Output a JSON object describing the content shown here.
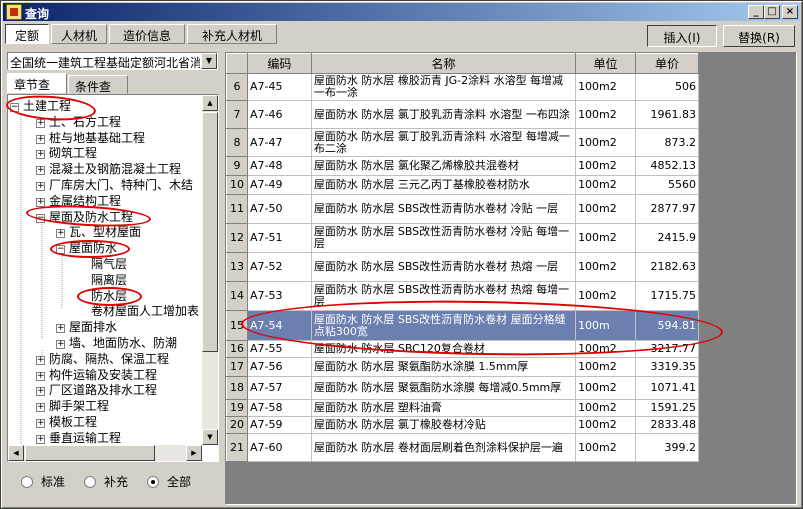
{
  "window": {
    "title": "查询",
    "controls": [
      "_",
      "□",
      "×"
    ]
  },
  "main_tabs": [
    {
      "label": "定额",
      "active": true
    },
    {
      "label": "人材机",
      "active": false
    },
    {
      "label": "造价信息",
      "active": false
    },
    {
      "label": "补充人材机",
      "active": false
    }
  ],
  "toolbar": {
    "insert_label": "插入(I)",
    "replace_label": "替换(R)"
  },
  "left": {
    "quota_select": "全国统一建筑工程基础定额河北省消",
    "sub_tabs": [
      {
        "label": "章节查询",
        "active": true
      },
      {
        "label": "条件查询",
        "active": false
      }
    ],
    "tree": [
      {
        "label": "土建工程",
        "level": 0,
        "exp": "−"
      },
      {
        "label": "土、石方工程",
        "level": 1,
        "exp": "+"
      },
      {
        "label": "桩与地基基础工程",
        "level": 1,
        "exp": "+"
      },
      {
        "label": "砌筑工程",
        "level": 1,
        "exp": "+"
      },
      {
        "label": "混凝土及钢筋混凝土工程",
        "level": 1,
        "exp": "+"
      },
      {
        "label": "厂库房大门、特种门、木结",
        "level": 1,
        "exp": "+"
      },
      {
        "label": "金属结构工程",
        "level": 1,
        "exp": "+"
      },
      {
        "label": "屋面及防水工程",
        "level": 1,
        "exp": "−"
      },
      {
        "label": "瓦、型材屋面",
        "level": 2,
        "exp": "+"
      },
      {
        "label": "屋面防水",
        "level": 2,
        "exp": "−"
      },
      {
        "label": "隔气层",
        "level": 3,
        "exp": ""
      },
      {
        "label": "隔离层",
        "level": 3,
        "exp": ""
      },
      {
        "label": "防水层",
        "level": 3,
        "exp": ""
      },
      {
        "label": "卷材屋面人工增加表",
        "level": 3,
        "exp": ""
      },
      {
        "label": "屋面排水",
        "level": 2,
        "exp": "+"
      },
      {
        "label": "墙、地面防水、防潮",
        "level": 2,
        "exp": "+"
      },
      {
        "label": "防腐、隔热、保温工程",
        "level": 1,
        "exp": "+"
      },
      {
        "label": "构件运输及安装工程",
        "level": 1,
        "exp": "+"
      },
      {
        "label": "厂区道路及排水工程",
        "level": 1,
        "exp": "+"
      },
      {
        "label": "脚手架工程",
        "level": 1,
        "exp": "+"
      },
      {
        "label": "模板工程",
        "level": 1,
        "exp": "+"
      },
      {
        "label": "垂直运输工程",
        "level": 1,
        "exp": "+"
      }
    ],
    "radios": [
      {
        "label": "标准",
        "checked": false
      },
      {
        "label": "补充",
        "checked": false
      },
      {
        "label": "全部",
        "checked": true
      }
    ]
  },
  "grid": {
    "columns": [
      "编码",
      "名称",
      "单位",
      "单价"
    ],
    "rows": [
      {
        "n": "6",
        "code": "A7-45",
        "name": "屋面防水 防水层 橡胶沥青 JG-2涂料 水溶型 每增减一布一涂",
        "unit": "100m2",
        "price": "506"
      },
      {
        "n": "7",
        "code": "A7-46",
        "name": "屋面防水 防水层 氯丁胶乳沥青涂料 水溶型 一布四涂",
        "unit": "100m2",
        "price": "1961.83"
      },
      {
        "n": "8",
        "code": "A7-47",
        "name": "屋面防水 防水层 氯丁胶乳沥青涂料 水溶型 每增减一布二涂",
        "unit": "100m2",
        "price": "873.2"
      },
      {
        "n": "9",
        "code": "A7-48",
        "name": "屋面防水 防水层 氯化聚乙烯橡胶共混卷材",
        "unit": "100m2",
        "price": "4852.13"
      },
      {
        "n": "10",
        "code": "A7-49",
        "name": "屋面防水 防水层 三元乙丙丁基橡胶卷材防水",
        "unit": "100m2",
        "price": "5560"
      },
      {
        "n": "11",
        "code": "A7-50",
        "name": "屋面防水 防水层 SBS改性沥青防水卷材 冷贴 一层",
        "unit": "100m2",
        "price": "2877.97"
      },
      {
        "n": "12",
        "code": "A7-51",
        "name": "屋面防水 防水层 SBS改性沥青防水卷材 冷贴 每增一层",
        "unit": "100m2",
        "price": "2415.9"
      },
      {
        "n": "13",
        "code": "A7-52",
        "name": "屋面防水 防水层 SBS改性沥青防水卷材 热熔 一层",
        "unit": "100m2",
        "price": "2182.63"
      },
      {
        "n": "14",
        "code": "A7-53",
        "name": "屋面防水 防水层 SBS改性沥青防水卷材 热熔 每增一层",
        "unit": "100m2",
        "price": "1715.75"
      },
      {
        "n": "15",
        "code": "A7-54",
        "name": "屋面防水 防水层 SBS改性沥青防水卷材 屋面分格缝 点粘300宽",
        "unit": "100m",
        "price": "594.81",
        "selected": true
      },
      {
        "n": "16",
        "code": "A7-55",
        "name": "屋面防水 防水层 SBC120复合卷材",
        "unit": "100m2",
        "price": "3217.77"
      },
      {
        "n": "17",
        "code": "A7-56",
        "name": "屋面防水 防水层 聚氨酯防水涂膜 1.5mm厚",
        "unit": "100m2",
        "price": "3319.35"
      },
      {
        "n": "18",
        "code": "A7-57",
        "name": "屋面防水 防水层 聚氨酯防水涂膜 每增减0.5mm厚",
        "unit": "100m2",
        "price": "1071.41"
      },
      {
        "n": "19",
        "code": "A7-58",
        "name": "屋面防水 防水层 塑料油膏",
        "unit": "100m2",
        "price": "1591.25"
      },
      {
        "n": "20",
        "code": "A7-59",
        "name": "屋面防水 防水层 氯丁橡胶卷材冷贴",
        "unit": "100m2",
        "price": "2833.48"
      },
      {
        "n": "21",
        "code": "A7-60",
        "name": "屋面防水 防水层 卷材面层刷着色剂涂料保护层一遍",
        "unit": "100m2",
        "price": "399.2"
      }
    ]
  },
  "colors": {
    "selection": "#6b7fb0",
    "annotation": "#e00000",
    "titlebar": "#0a246a"
  }
}
